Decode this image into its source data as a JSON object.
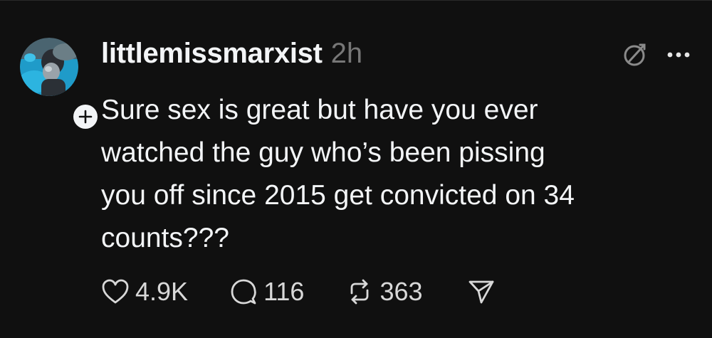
{
  "post": {
    "username": "littlemissmarxist",
    "timestamp": "2h",
    "text": "Sure sex is great but have you ever\nwatched the guy who’s been pissing\nyou off since 2015 get convicted on 34\ncounts???",
    "icons": {
      "avatar": "avatar-image",
      "follow": "plus-icon",
      "muted": "no-audio-icon",
      "more": "more-icon",
      "like": "heart-icon",
      "reply": "comment-icon",
      "repost": "repost-icon",
      "share": "send-icon"
    },
    "stats": {
      "likes": "4.9K",
      "replies": "116",
      "reposts": "363"
    }
  },
  "colors": {
    "background": "#101010",
    "text": "#f3f5f7",
    "secondary": "#777777"
  }
}
